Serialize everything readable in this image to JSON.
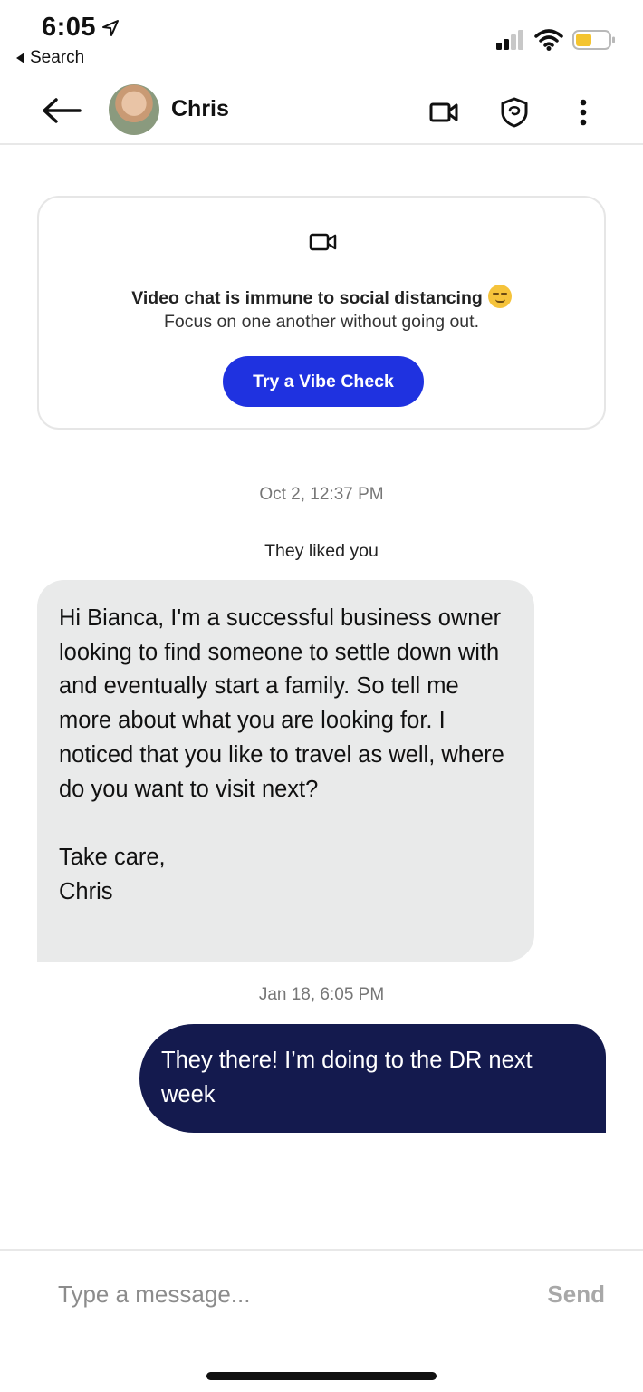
{
  "status_bar": {
    "time": "6:05",
    "back_label": "Search",
    "battery_color": "#f4c430"
  },
  "header": {
    "contact_name": "Chris",
    "icons": [
      "back-arrow-icon",
      "video-camera-icon",
      "shield-icon",
      "more-vertical-icon"
    ]
  },
  "promo": {
    "icon": "video-camera-icon",
    "title": "Video chat is immune to social distancing",
    "emoji": "smirking-face",
    "subtitle": "Focus on one another without going out.",
    "button_label": "Try a Vibe Check",
    "button_color": "#1f32e0"
  },
  "messages": {
    "timestamp_1": "Oct 2, 12:37 PM",
    "liked_notice": "They liked you",
    "incoming_text": "Hi Bianca, I'm a successful business owner looking to find someone to settle down with and eventually start a family. So tell me more about what you are looking for. I noticed that you like to travel as well, where do you want to visit next?\n\nTake care,\nChris",
    "timestamp_2": "Jan 18, 6:05 PM",
    "outgoing_text": "They there! I’m doing to the DR next week",
    "outgoing_color": "#141a4e"
  },
  "composer": {
    "placeholder": "Type a message...",
    "value": "",
    "send_label": "Send"
  }
}
